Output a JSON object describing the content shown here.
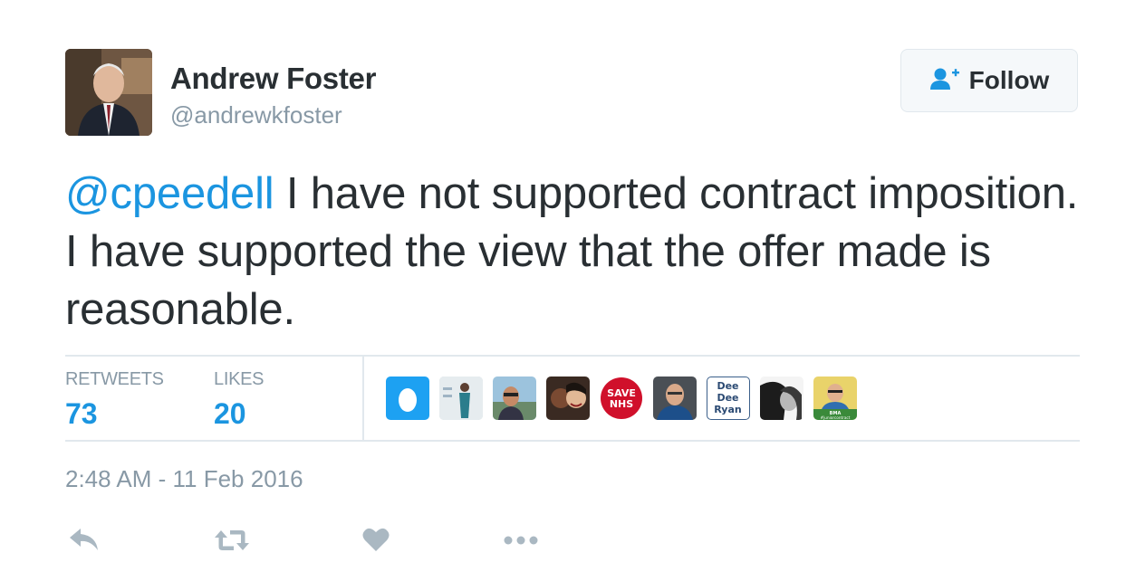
{
  "author": {
    "name": "Andrew Foster",
    "handle": "@andrewkfoster"
  },
  "follow_button": {
    "label": "Follow"
  },
  "tweet": {
    "mention": "@cpeedell",
    "text": " I have not supported contract imposition. I have supported the view that the offer made is reasonable."
  },
  "stats": {
    "retweets_label": "RETWEETS",
    "retweets_value": "73",
    "likes_label": "LIKES",
    "likes_value": "20"
  },
  "likers": [
    {
      "name": "default-egg-avatar"
    },
    {
      "name": "person-standing-avatar"
    },
    {
      "name": "man-outdoors-avatar"
    },
    {
      "name": "two-women-avatar"
    },
    {
      "name": "save-nhs-avatar",
      "text": "SAVE NHS"
    },
    {
      "name": "man-portrait-avatar"
    },
    {
      "name": "dee-dee-ryan-avatar",
      "text": "Dee Dee Ryan"
    },
    {
      "name": "bw-couple-avatar"
    },
    {
      "name": "bma-junior-contract-avatar",
      "text": "BMA #juniorcontract"
    }
  ],
  "timestamp": "2:48 AM - 11 Feb 2016",
  "actions": [
    "reply-icon",
    "retweet-icon",
    "like-icon",
    "more-icon"
  ],
  "colors": {
    "link": "#1b95e0",
    "text": "#292f33",
    "muted": "#8899a6",
    "divider": "#e1e8ed",
    "egg_blue": "#1da1f2",
    "save_nhs_red": "#d0102b",
    "bma_green": "#3a8a3a"
  }
}
